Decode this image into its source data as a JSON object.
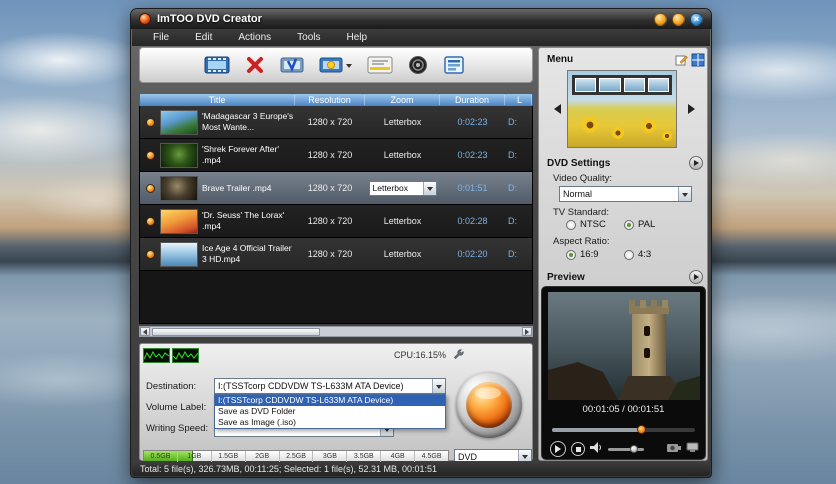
{
  "window": {
    "title": "ImTOO DVD Creator",
    "menu_items": [
      "File",
      "Edit",
      "Actions",
      "Tools",
      "Help"
    ],
    "close_glyph": "×"
  },
  "toolbar": {
    "icons": [
      "add-video",
      "remove-video",
      "clip-video",
      "video-effects",
      "subtitle",
      "audio",
      "menu-editor"
    ]
  },
  "file_table": {
    "columns": {
      "title": "Title",
      "resolution": "Resolution",
      "zoom": "Zoom",
      "duration": "Duration",
      "lang": "L"
    },
    "rows": [
      {
        "title": "'Madagascar 3 Europe's Most Wante...",
        "resolution": "1280 x 720",
        "zoom": "Letterbox",
        "duration": "0:02:23",
        "lang": "D:",
        "selected": false
      },
      {
        "title": "'Shrek Forever After' .mp4",
        "resolution": "1280 x 720",
        "zoom": "Letterbox",
        "duration": "0:02:23",
        "lang": "D:",
        "selected": false
      },
      {
        "title": "Brave Trailer .mp4",
        "resolution": "1280 x 720",
        "zoom": "Letterbox",
        "duration": "0:01:51",
        "lang": "D:",
        "selected": true
      },
      {
        "title": "'Dr. Seuss' The Lorax' .mp4",
        "resolution": "1280 x 720",
        "zoom": "Letterbox",
        "duration": "0:02:28",
        "lang": "D:",
        "selected": false
      },
      {
        "title": "Ice Age 4 Official Trailer 3 HD.mp4",
        "resolution": "1280 x 720",
        "zoom": "Letterbox",
        "duration": "0:02:20",
        "lang": "D:",
        "selected": false
      }
    ]
  },
  "performance": {
    "cpu": "CPU:16.15%"
  },
  "output": {
    "destination": {
      "label": "Destination:",
      "value": "I:(TSSTcorp CDDVDW TS-L633M ATA Device)"
    },
    "volume": {
      "label": "Volume Label:"
    },
    "speed": {
      "label": "Writing Speed:"
    },
    "destination_options": [
      "I:(TSSTcorp CDDVDW TS-L633M ATA Device)",
      "Save as DVD Folder",
      "Save as Image (.iso)"
    ],
    "selected_option_index": 0,
    "capacity_ticks": [
      "0.5GB",
      "1GB",
      "1.5GB",
      "2GB",
      "2.5GB",
      "3GB",
      "3.5GB",
      "4GB",
      "4.5GB"
    ],
    "disc_type": "DVD"
  },
  "status_bar": {
    "text": "Total: 5 file(s), 326.73MB, 00:11:25; Selected: 1 file(s), 52.31 MB, 00:01:51"
  },
  "sidebar": {
    "menu": {
      "title": "Menu"
    },
    "dvd_settings": {
      "title": "DVD Settings",
      "video_quality_label": "Video Quality:",
      "video_quality_value": "Normal",
      "tv_standard_label": "TV Standard:",
      "tv_options": [
        {
          "label": "NTSC",
          "selected": false
        },
        {
          "label": "PAL",
          "selected": true
        }
      ],
      "aspect_label": "Aspect Ratio:",
      "aspect_options": [
        {
          "label": "16:9",
          "selected": true
        },
        {
          "label": "4:3",
          "selected": false
        }
      ]
    },
    "preview": {
      "title": "Preview",
      "time": "00:01:05 / 00:01:51"
    }
  },
  "colors": {
    "table_header": "#4a84c4",
    "selection_blue": "#2f62b5",
    "burn_orange": "#f07818",
    "capacity_green": "#4da818",
    "link_blue": "#7db4ea"
  }
}
